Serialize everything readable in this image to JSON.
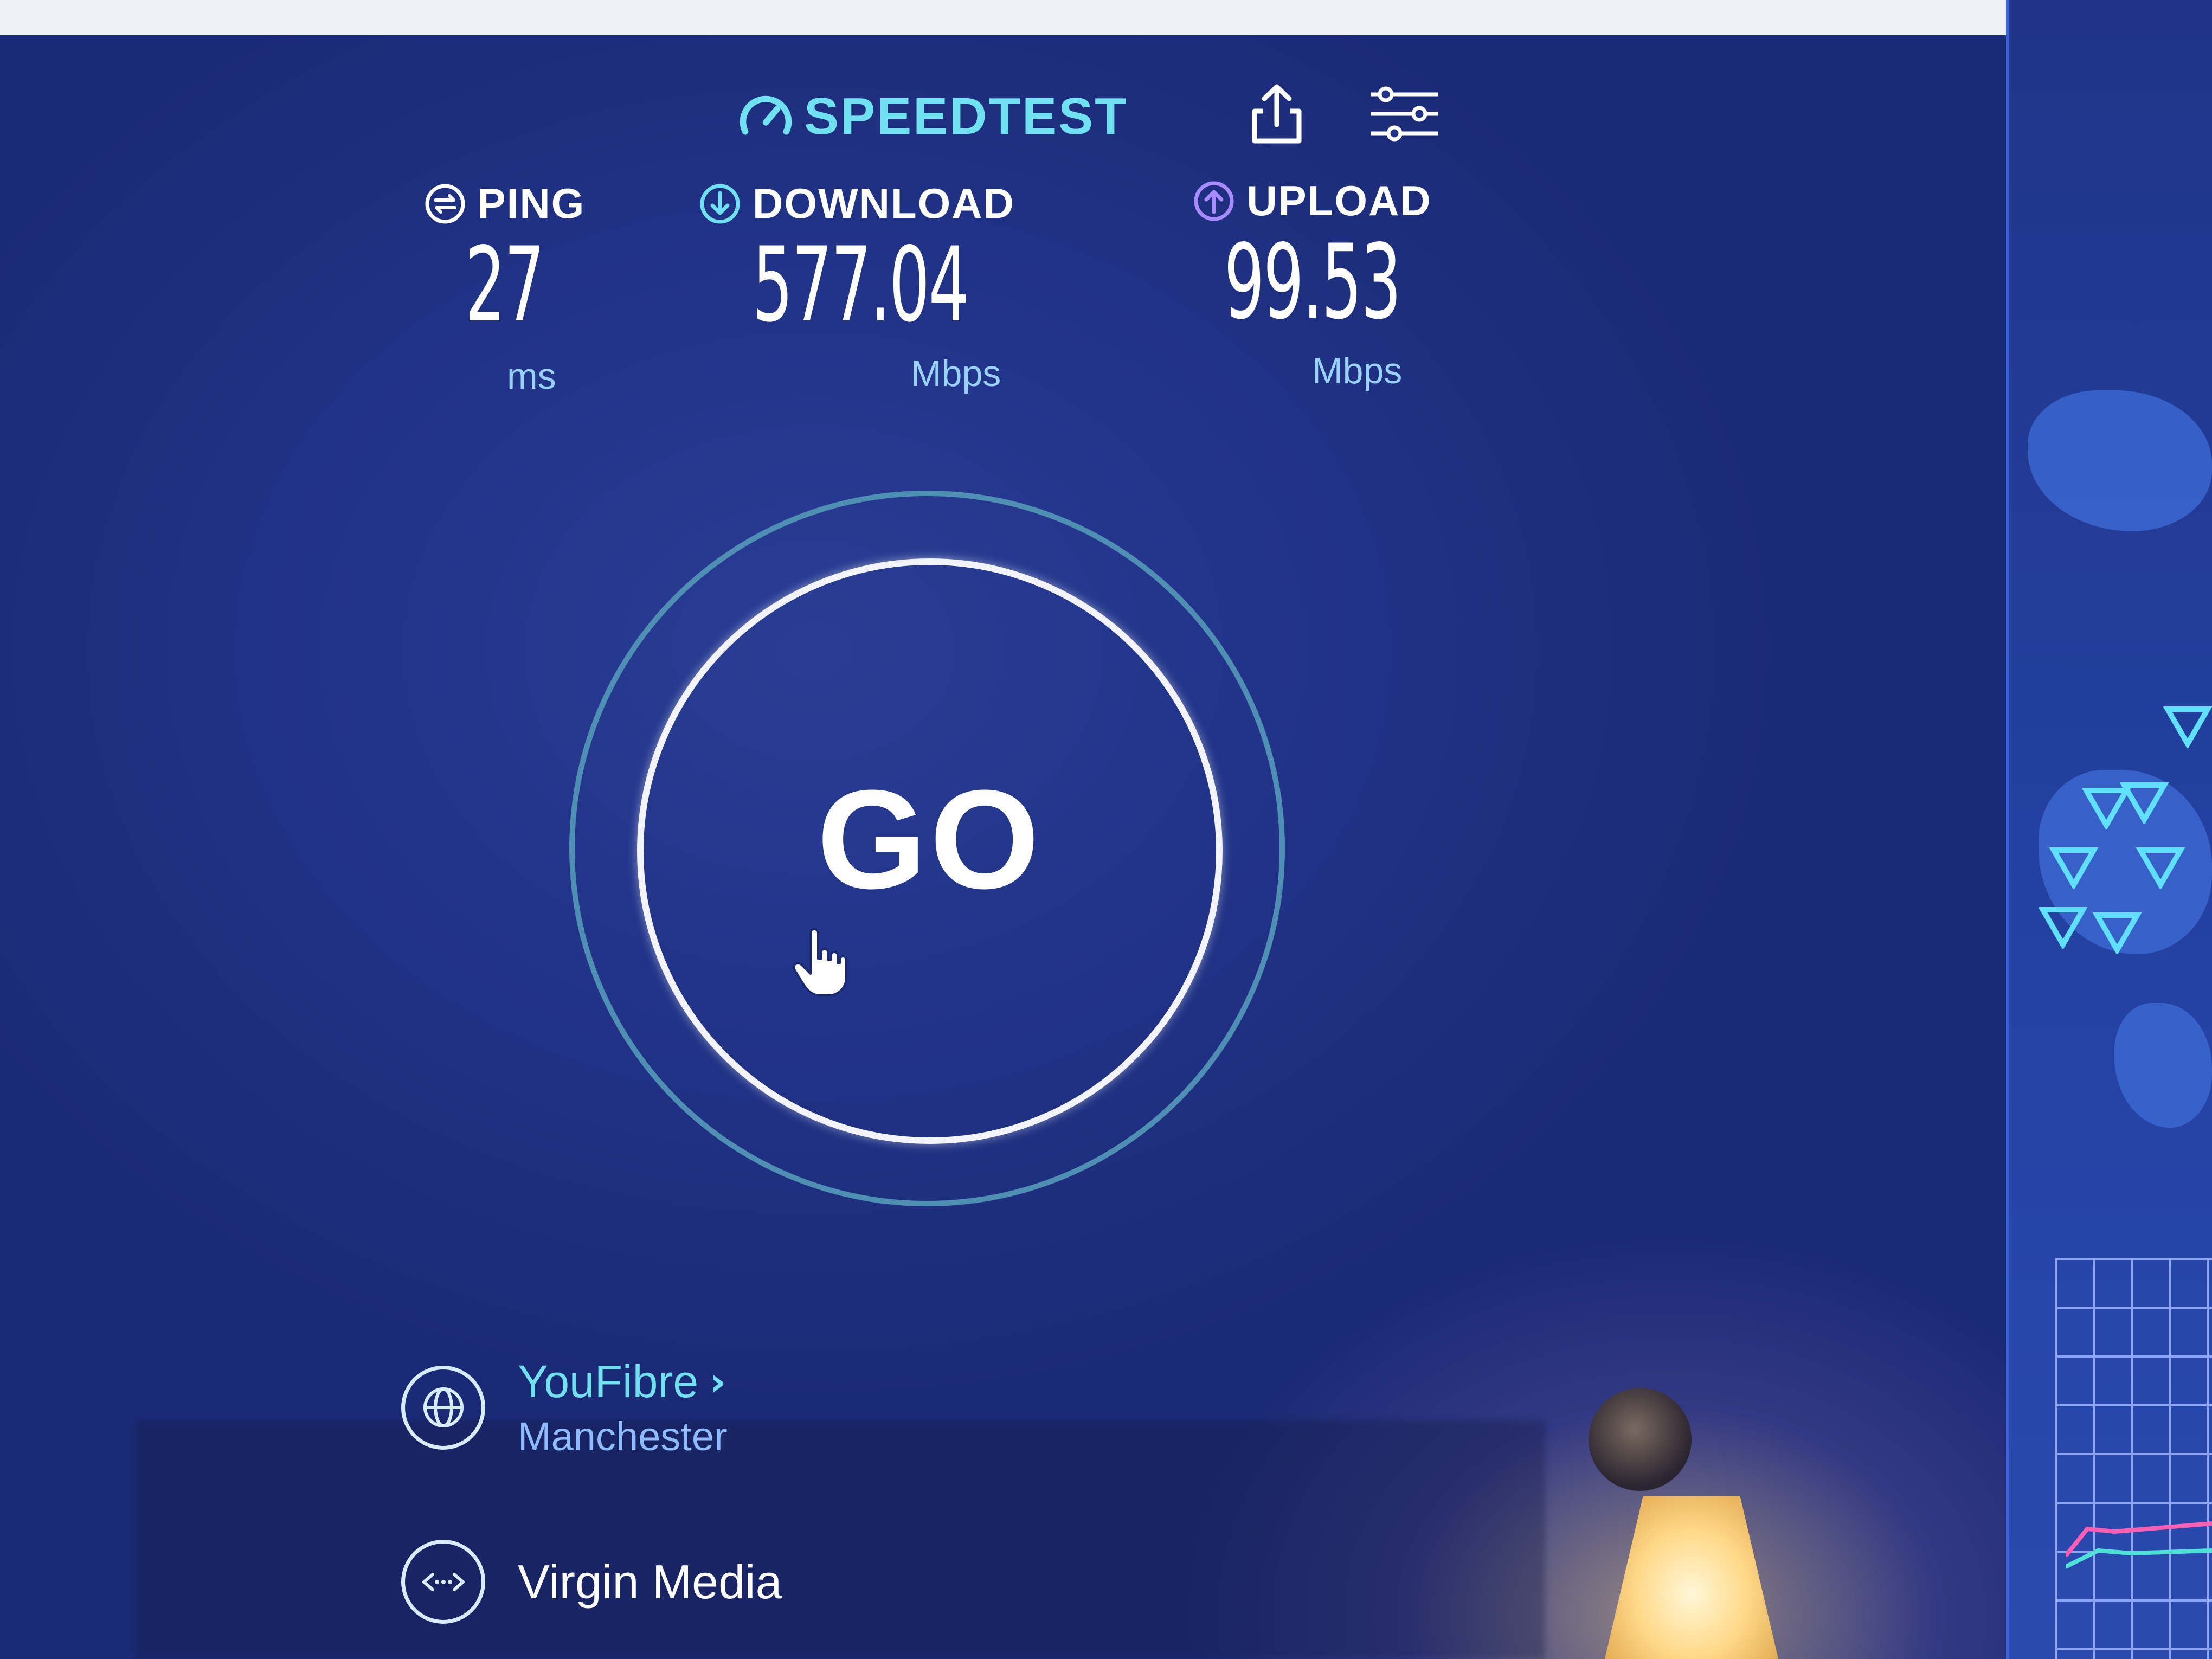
{
  "app": {
    "name": "SPEEDTEST"
  },
  "metrics": {
    "ping": {
      "label": "PING",
      "value": "27",
      "unit": "ms"
    },
    "download": {
      "label": "DOWNLOAD",
      "value": "577.04",
      "unit": "Mbps"
    },
    "upload": {
      "label": "UPLOAD",
      "value": "99.53",
      "unit": "Mbps"
    }
  },
  "go_button": {
    "label": "GO"
  },
  "provider": {
    "isp": "YouFibre",
    "isp_location": "Manchester",
    "server": "Virgin Media"
  },
  "colors": {
    "background": "#22348a",
    "accent": "#6fe1f0",
    "text": "#ffffff",
    "unit": "#9ad2ff",
    "ring_outer": "#4f8fb4"
  },
  "icons": {
    "logo": "speedometer-icon",
    "share": "share-icon",
    "settings": "settings-sliders-icon",
    "ping": "ping-icon",
    "download": "download-arrow-icon",
    "upload": "upload-arrow-icon",
    "isp": "globe-icon",
    "server": "server-connection-icon",
    "cursor": "hand-pointer-icon"
  }
}
